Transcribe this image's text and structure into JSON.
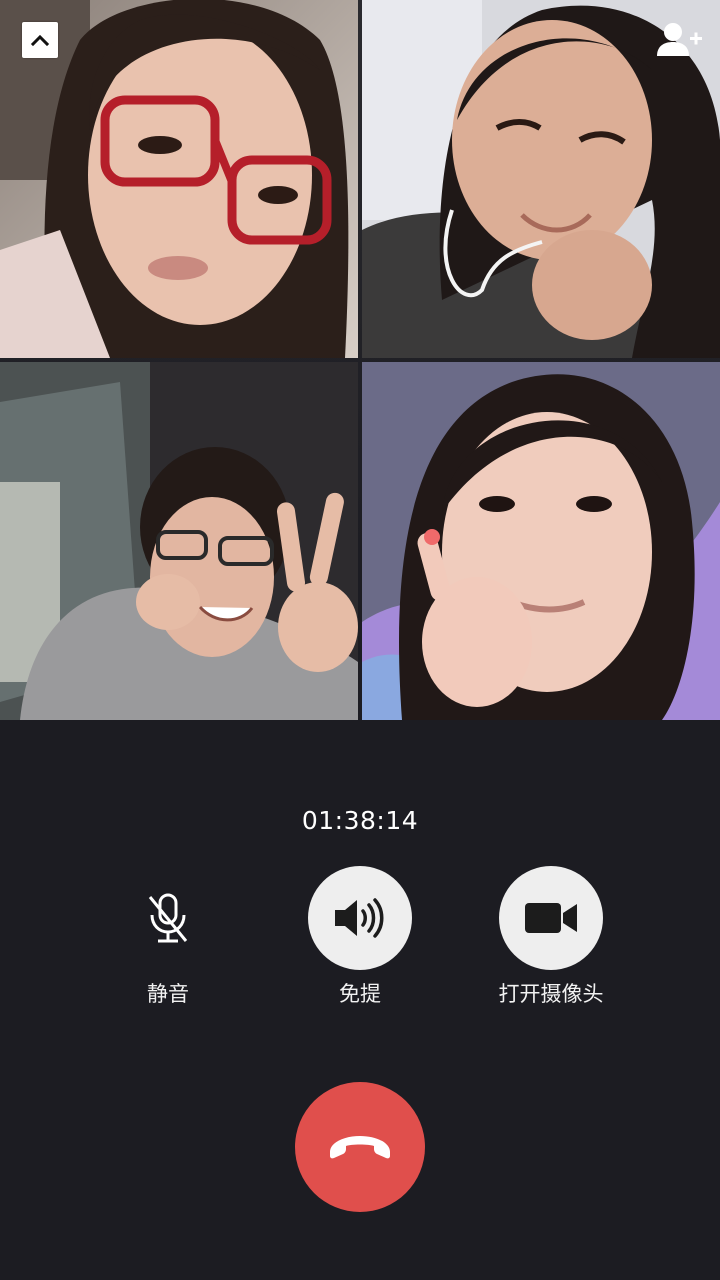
{
  "call": {
    "timer": "01:38:14"
  },
  "controls": {
    "mute_label": "静音",
    "speaker_label": "免提",
    "camera_label": "打开摄像头"
  },
  "icons": {
    "minimize": "chevron-up-icon",
    "add_member": "add-person-icon",
    "mute": "microphone-off-icon",
    "speaker": "speaker-icon",
    "camera": "video-camera-icon",
    "hangup": "phone-hangup-icon"
  },
  "colors": {
    "background": "#1f1f24",
    "control_circle": "#eeeeee",
    "hangup": "#e04f4c",
    "text": "#ffffff"
  },
  "participants": [
    {
      "tile": "participant-video"
    },
    {
      "tile": "participant-video"
    },
    {
      "tile": "participant-video"
    },
    {
      "tile": "participant-video"
    }
  ]
}
